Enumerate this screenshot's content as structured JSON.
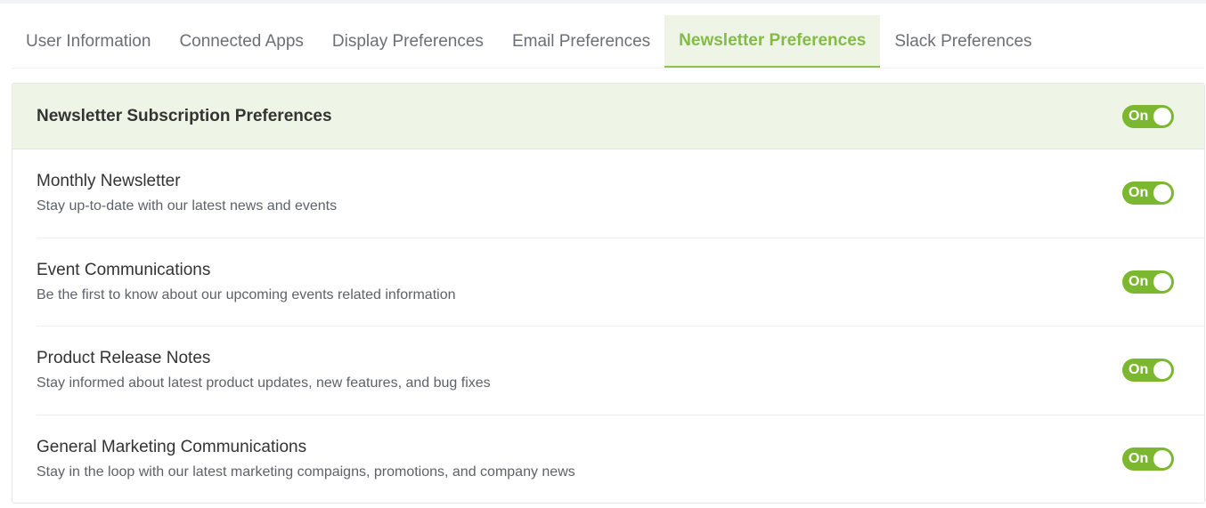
{
  "tabs": [
    {
      "label": "User Information",
      "active": false
    },
    {
      "label": "Connected Apps",
      "active": false
    },
    {
      "label": "Display Preferences",
      "active": false
    },
    {
      "label": "Email Preferences",
      "active": false
    },
    {
      "label": "Newsletter Preferences",
      "active": true
    },
    {
      "label": "Slack Preferences",
      "active": false
    }
  ],
  "panel": {
    "title": "Newsletter Subscription Preferences",
    "master_toggle": {
      "label": "On",
      "state": "on"
    }
  },
  "preferences": [
    {
      "title": "Monthly Newsletter",
      "description": "Stay up-to-date with our latest news and events",
      "toggle": "On"
    },
    {
      "title": "Event Communications",
      "description": "Be the first to know about our upcoming events related information",
      "toggle": "On"
    },
    {
      "title": "Product Release Notes",
      "description": "Stay informed about latest product updates, new features, and bug fixes",
      "toggle": "On"
    },
    {
      "title": "General Marketing Communications",
      "description": "Stay in the loop with our latest marketing compaigns, promotions, and company news",
      "toggle": "On"
    }
  ],
  "colors": {
    "accent": "#7cb82f",
    "active_tab_text": "#84bb47",
    "header_bg": "#eff5e6"
  }
}
